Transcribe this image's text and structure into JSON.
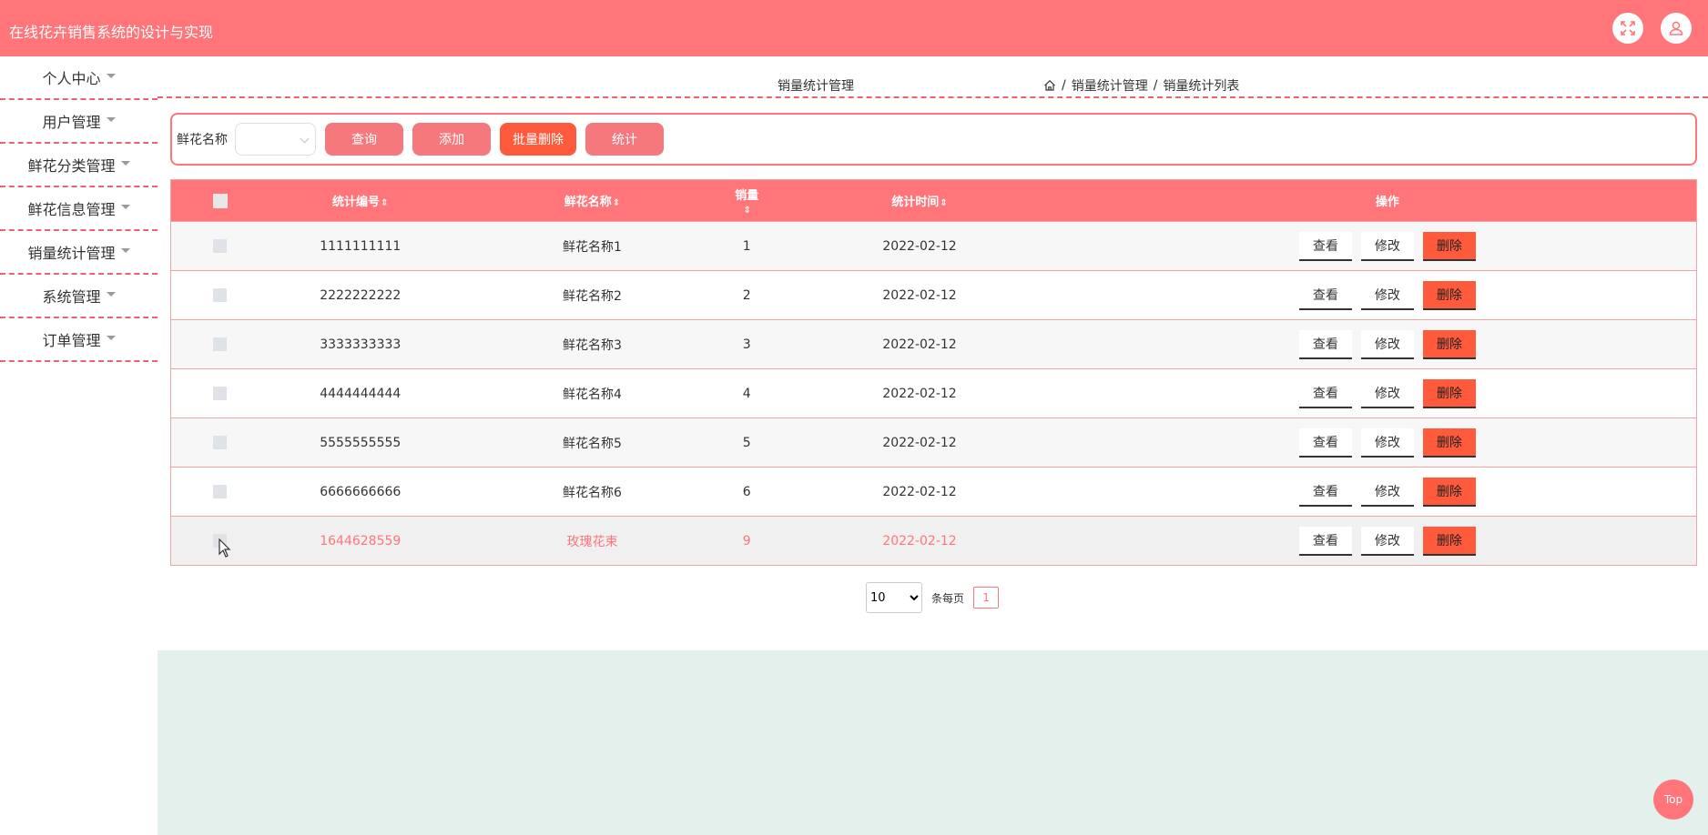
{
  "app": {
    "title": "在线花卉销售系统的设计与实现"
  },
  "header": {
    "fullscreen_icon": "fullscreen-icon",
    "user_icon": "user-icon"
  },
  "sidebar": {
    "items": [
      {
        "label": "个人中心"
      },
      {
        "label": "用户管理"
      },
      {
        "label": "鲜花分类管理"
      },
      {
        "label": "鲜花信息管理"
      },
      {
        "label": "销量统计管理"
      },
      {
        "label": "系统管理"
      },
      {
        "label": "订单管理"
      }
    ]
  },
  "breadcrumb": {
    "title": "销量统计管理",
    "home_icon": "home-icon",
    "sep1": "/",
    "level1": "销量统计管理",
    "sep2": "/",
    "level2": "销量统计列表"
  },
  "search": {
    "label": "鲜花名称",
    "select_value": "",
    "btn_query": "查询",
    "btn_add": "添加",
    "btn_batch_delete": "批量删除",
    "btn_stat": "统计"
  },
  "table": {
    "headers": {
      "id": "统计编号",
      "name": "鲜花名称",
      "qty": "销量",
      "time": "统计时间",
      "op": "操作"
    },
    "sort_icon": "sort-icon",
    "op_labels": {
      "view": "查看",
      "edit": "修改",
      "delete": "删除"
    },
    "rows": [
      {
        "id": "1111111111",
        "name": "鲜花名称1",
        "qty": "1",
        "time": "2022-02-12"
      },
      {
        "id": "2222222222",
        "name": "鲜花名称2",
        "qty": "2",
        "time": "2022-02-12"
      },
      {
        "id": "3333333333",
        "name": "鲜花名称3",
        "qty": "3",
        "time": "2022-02-12"
      },
      {
        "id": "4444444444",
        "name": "鲜花名称4",
        "qty": "4",
        "time": "2022-02-12"
      },
      {
        "id": "5555555555",
        "name": "鲜花名称5",
        "qty": "5",
        "time": "2022-02-12"
      },
      {
        "id": "6666666666",
        "name": "鲜花名称6",
        "qty": "6",
        "time": "2022-02-12"
      },
      {
        "id": "1644628559",
        "name": "玫瑰花束",
        "qty": "9",
        "time": "2022-02-12"
      }
    ]
  },
  "pager": {
    "page_size": "10",
    "page_size_options": [
      "10"
    ],
    "per_page_label": "条每页",
    "current_page": "1"
  },
  "top_button": "Top",
  "colors": {
    "primary": "#ff757a",
    "danger": "#ff5a3c",
    "footer": "#e3f0ec"
  }
}
